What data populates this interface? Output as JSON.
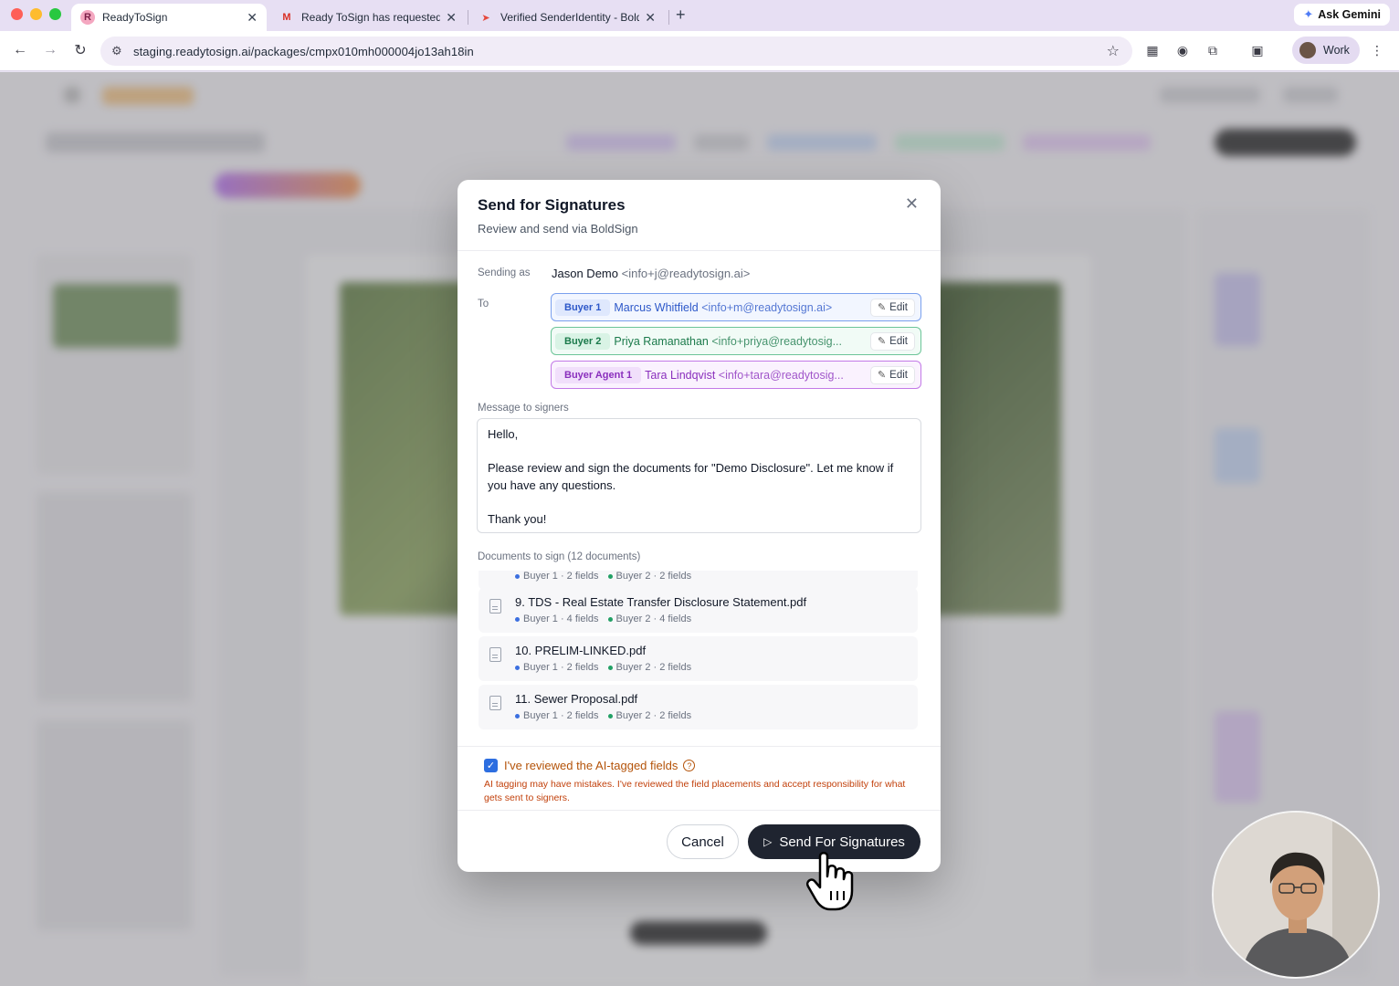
{
  "browser": {
    "tabs": [
      {
        "title": "ReadyToSign",
        "favicon": "R"
      },
      {
        "title": "Ready ToSign has requested y",
        "favicon": "M"
      },
      {
        "title": "Verified SenderIdentity - Bold",
        "favicon": "B"
      }
    ],
    "new_tab": "+",
    "ask_gemini": "Ask Gemini",
    "url": "staging.readytosign.ai/packages/cmpx010mh000004jo13ah18in",
    "profile": "Work"
  },
  "modal": {
    "title": "Send for Signatures",
    "subtitle": "Review and send via BoldSign",
    "sending_as_label": "Sending as",
    "sender_name": "Jason Demo",
    "sender_email": "<info+j@readytosign.ai>",
    "to_label": "To",
    "recipients": [
      {
        "role": "Buyer 1",
        "name": "Marcus Whitfield",
        "email": "<info+m@readytosign.ai>",
        "edit": "Edit",
        "color": "#2d58c9"
      },
      {
        "role": "Buyer 2",
        "name": "Priya Ramanathan",
        "email": "<info+priya@readytosig...",
        "edit": "Edit",
        "color": "#1b7a4b"
      },
      {
        "role": "Buyer Agent 1",
        "name": "Tara Lindqvist",
        "email": "<info+tara@readytosig...",
        "edit": "Edit",
        "color": "#8a2fbd"
      }
    ],
    "message_label": "Message to signers",
    "message": "Hello,\n\nPlease review and sign the documents for \"Demo Disclosure\". Let me know if you have any questions.\n\nThank you!",
    "documents_label": "Documents to sign (12 documents)",
    "documents": [
      {
        "name": "",
        "buyer1": "Buyer 1 · 2 fields",
        "buyer2": "Buyer 2 · 2 fields"
      },
      {
        "name": "9. TDS - Real Estate Transfer Disclosure Statement.pdf",
        "buyer1": "Buyer 1 · 4 fields",
        "buyer2": "Buyer 2 · 4 fields"
      },
      {
        "name": "10. PRELIM-LINKED.pdf",
        "buyer1": "Buyer 1 · 2 fields",
        "buyer2": "Buyer 2 · 2 fields"
      },
      {
        "name": "11. Sewer Proposal.pdf",
        "buyer1": "Buyer 1 · 2 fields",
        "buyer2": "Buyer 2 · 2 fields"
      }
    ],
    "review_checked": true,
    "review_label": "I've reviewed the AI-tagged fields",
    "review_warning": "AI tagging may have mistakes. I've reviewed the field placements and accept responsibility for what gets sent to signers.",
    "cancel": "Cancel",
    "send": "Send For Signatures"
  }
}
